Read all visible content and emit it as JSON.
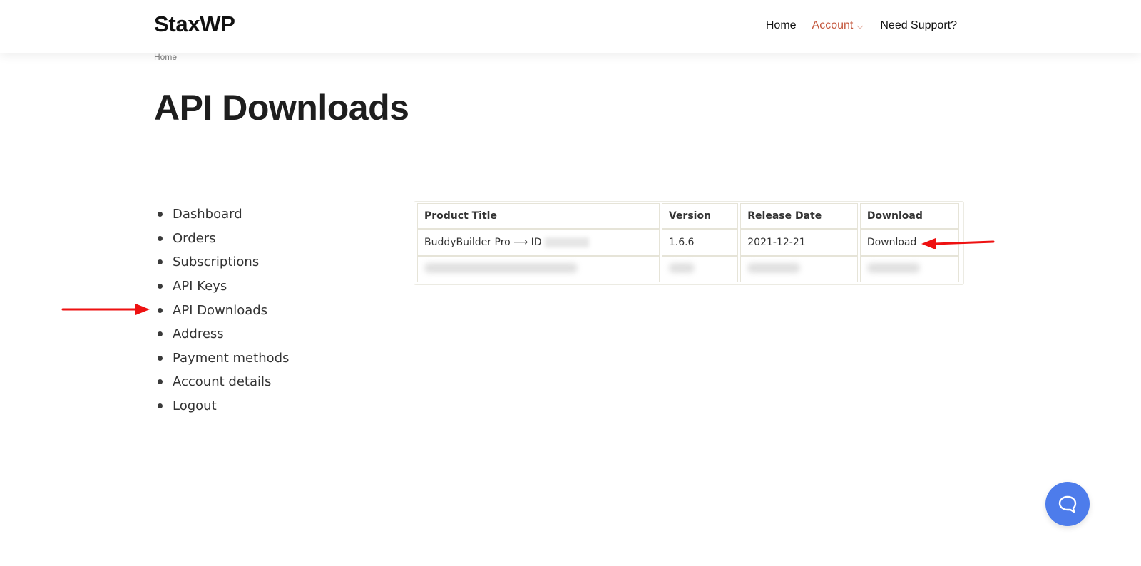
{
  "header": {
    "logo": "StaxWP",
    "nav": [
      {
        "label": "Home"
      },
      {
        "label": "Account",
        "active": true
      },
      {
        "label": "Need Support?"
      }
    ]
  },
  "breadcrumb": "Home",
  "page_title": "API Downloads",
  "account_nav": {
    "items": [
      {
        "label": "Dashboard"
      },
      {
        "label": "Orders"
      },
      {
        "label": "Subscriptions"
      },
      {
        "label": "API Keys"
      },
      {
        "label": "API Downloads"
      },
      {
        "label": "Address"
      },
      {
        "label": "Payment methods"
      },
      {
        "label": "Account details"
      },
      {
        "label": "Logout"
      }
    ]
  },
  "downloads_table": {
    "headers": [
      "Product Title",
      "Version",
      "Release Date",
      "Download"
    ],
    "rows": [
      {
        "product": "BuddyBuilder Pro ⟶ ID",
        "version": "1.6.6",
        "release_date": "2021-12-21",
        "download": "Download"
      }
    ]
  },
  "icons": {
    "chat": "chat-bubble-icon",
    "account_dropdown": "chevron-down-icon",
    "annotation_arrows": "red-arrow-icon"
  },
  "colors": {
    "accent": "#c4573d",
    "chat_button": "#4d7ceb",
    "annotation": "#ee1111"
  }
}
